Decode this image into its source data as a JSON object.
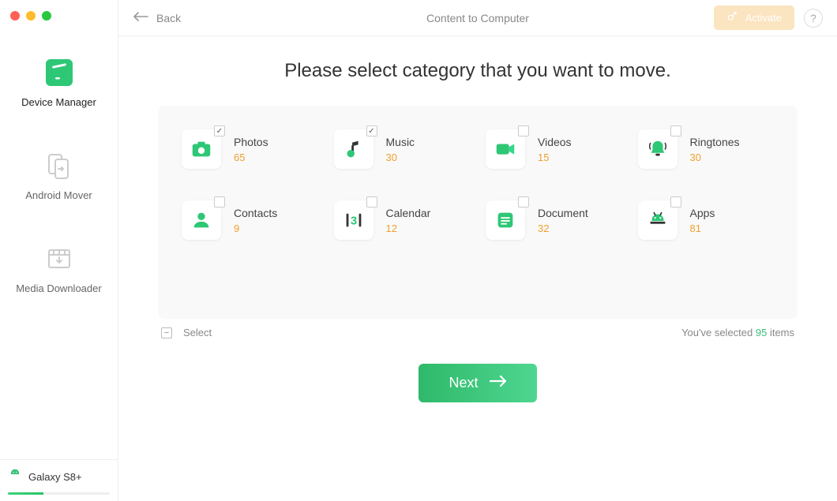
{
  "sidebar": {
    "items": [
      {
        "label": "Device Manager"
      },
      {
        "label": "Android Mover"
      },
      {
        "label": "Media Downloader"
      }
    ]
  },
  "device": {
    "name": "Galaxy S8+"
  },
  "topbar": {
    "back": "Back",
    "title": "Content to Computer",
    "activate": "Activate"
  },
  "heading": "Please select category that you want to move.",
  "categories": [
    {
      "label": "Photos",
      "count": "65",
      "checked": true
    },
    {
      "label": "Music",
      "count": "30",
      "checked": true
    },
    {
      "label": "Videos",
      "count": "15",
      "checked": false
    },
    {
      "label": "Ringtones",
      "count": "30",
      "checked": false
    },
    {
      "label": "Contacts",
      "count": "9",
      "checked": false
    },
    {
      "label": "Calendar",
      "count": "12",
      "checked": false
    },
    {
      "label": "Document",
      "count": "32",
      "checked": false
    },
    {
      "label": "Apps",
      "count": "81",
      "checked": false
    }
  ],
  "summary": {
    "select_label": "Select",
    "prefix": "You've selected ",
    "count": "95",
    "suffix": " items"
  },
  "next_label": "Next"
}
